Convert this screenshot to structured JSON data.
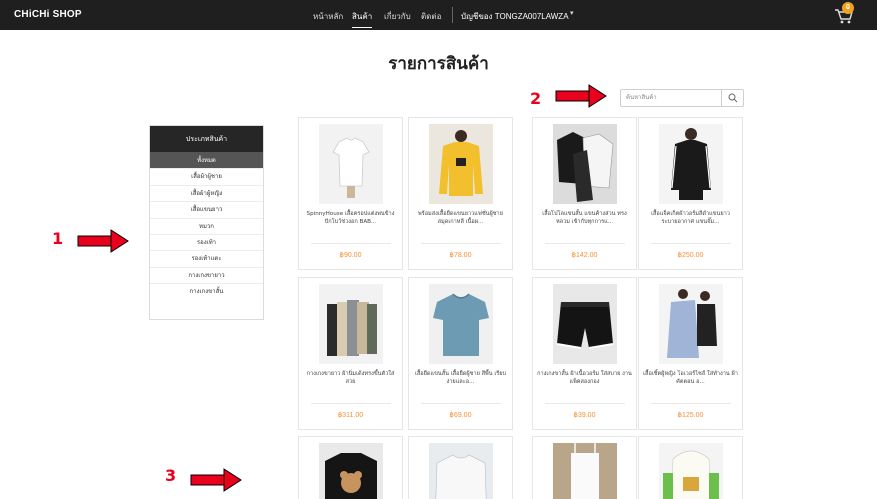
{
  "navbar": {
    "brand": "CHiCHi SHOP",
    "links": [
      "หน้าหลัก",
      "สินค้า",
      "เกี่ยวกับ",
      "ติดต่อ"
    ],
    "active_link": "สินค้า",
    "account": "บัญชีของ TONGZA007LAWZA",
    "cart_count": "0"
  },
  "page": {
    "title": "รายการสินค้า"
  },
  "search": {
    "placeholder": "ค้นหาสินค้า"
  },
  "annotations": [
    "1",
    "2",
    "3"
  ],
  "categories": {
    "header": "ประเภทสินค้า",
    "items": [
      "ทั้งหมด",
      "เสื้อผ้าผู้ชาย",
      "เสื้อผ้าผู้หญิง",
      "เสื้อแขนยาว",
      "หมวก",
      "รองเท้า",
      "รองเท้าแตะ",
      "กางเกงขายาว",
      "กางเกงขาสั้น"
    ],
    "selected": "ทั้งหมด"
  },
  "products": [
    {
      "name": "SpinnyHouse เสื้อครอปแต่งพ่นข้าง ปักโบว์ช่วงอก BAB...",
      "price": "฿90.00",
      "image": "white-crop-tee"
    },
    {
      "name": "พร้อมส่งเสื้อยืดแขนยาวแฟชั่นผู้ชาย สมุดเกาหลี เนื้อผ...",
      "price": "฿78.00",
      "image": "yellow-longsleeve"
    },
    {
      "name": "เสื้อโปโลแขนสั้น แขนค้างส่วน ทรงหลวม เข้ากับทุกการแ...",
      "price": "฿142.00",
      "image": "polo-shirts"
    },
    {
      "name": "เสื้อแจ็คเก็ตผ้าวอร์มสีดำแขนยาว ระบายอากาศ แขนจั๊ม...",
      "price": "฿250.00",
      "image": "black-jacket"
    },
    {
      "name": "กางเกงขายาว ผ้านิ่มเด้งทรงขึ้นตัวใส่สวย",
      "price": "฿311.00",
      "image": "pants-stack"
    },
    {
      "name": "เสื้อยืดแขนสั้น เสื้อยืดผู้ชาย สีพื้น เรียบง่ายและอ...",
      "price": "฿69.00",
      "image": "blue-tee"
    },
    {
      "name": "กางเกงขาสั้น ผ้าเนื้อวอร์ม ใส่สบาย งานแพ็คสองกอง",
      "price": "฿39.00",
      "image": "black-shorts"
    },
    {
      "name": "เสื้อเชิ้ตผู้หญิง โอเวอร์ไซส์ ใส่ทำงาน ผ้าคัตตอน อ...",
      "price": "฿125.00",
      "image": "blue-shirt"
    },
    {
      "name": "",
      "price": "",
      "image": "black-bear-tee"
    },
    {
      "name": "",
      "price": "",
      "image": "white-tee"
    },
    {
      "name": "",
      "price": "",
      "image": "white-top"
    },
    {
      "name": "",
      "price": "",
      "image": "green-hoodie"
    }
  ],
  "colors": {
    "navbar": "#1f1f1f",
    "price": "#f39237",
    "annotation": "#e8001c",
    "category_active": "#555555"
  }
}
